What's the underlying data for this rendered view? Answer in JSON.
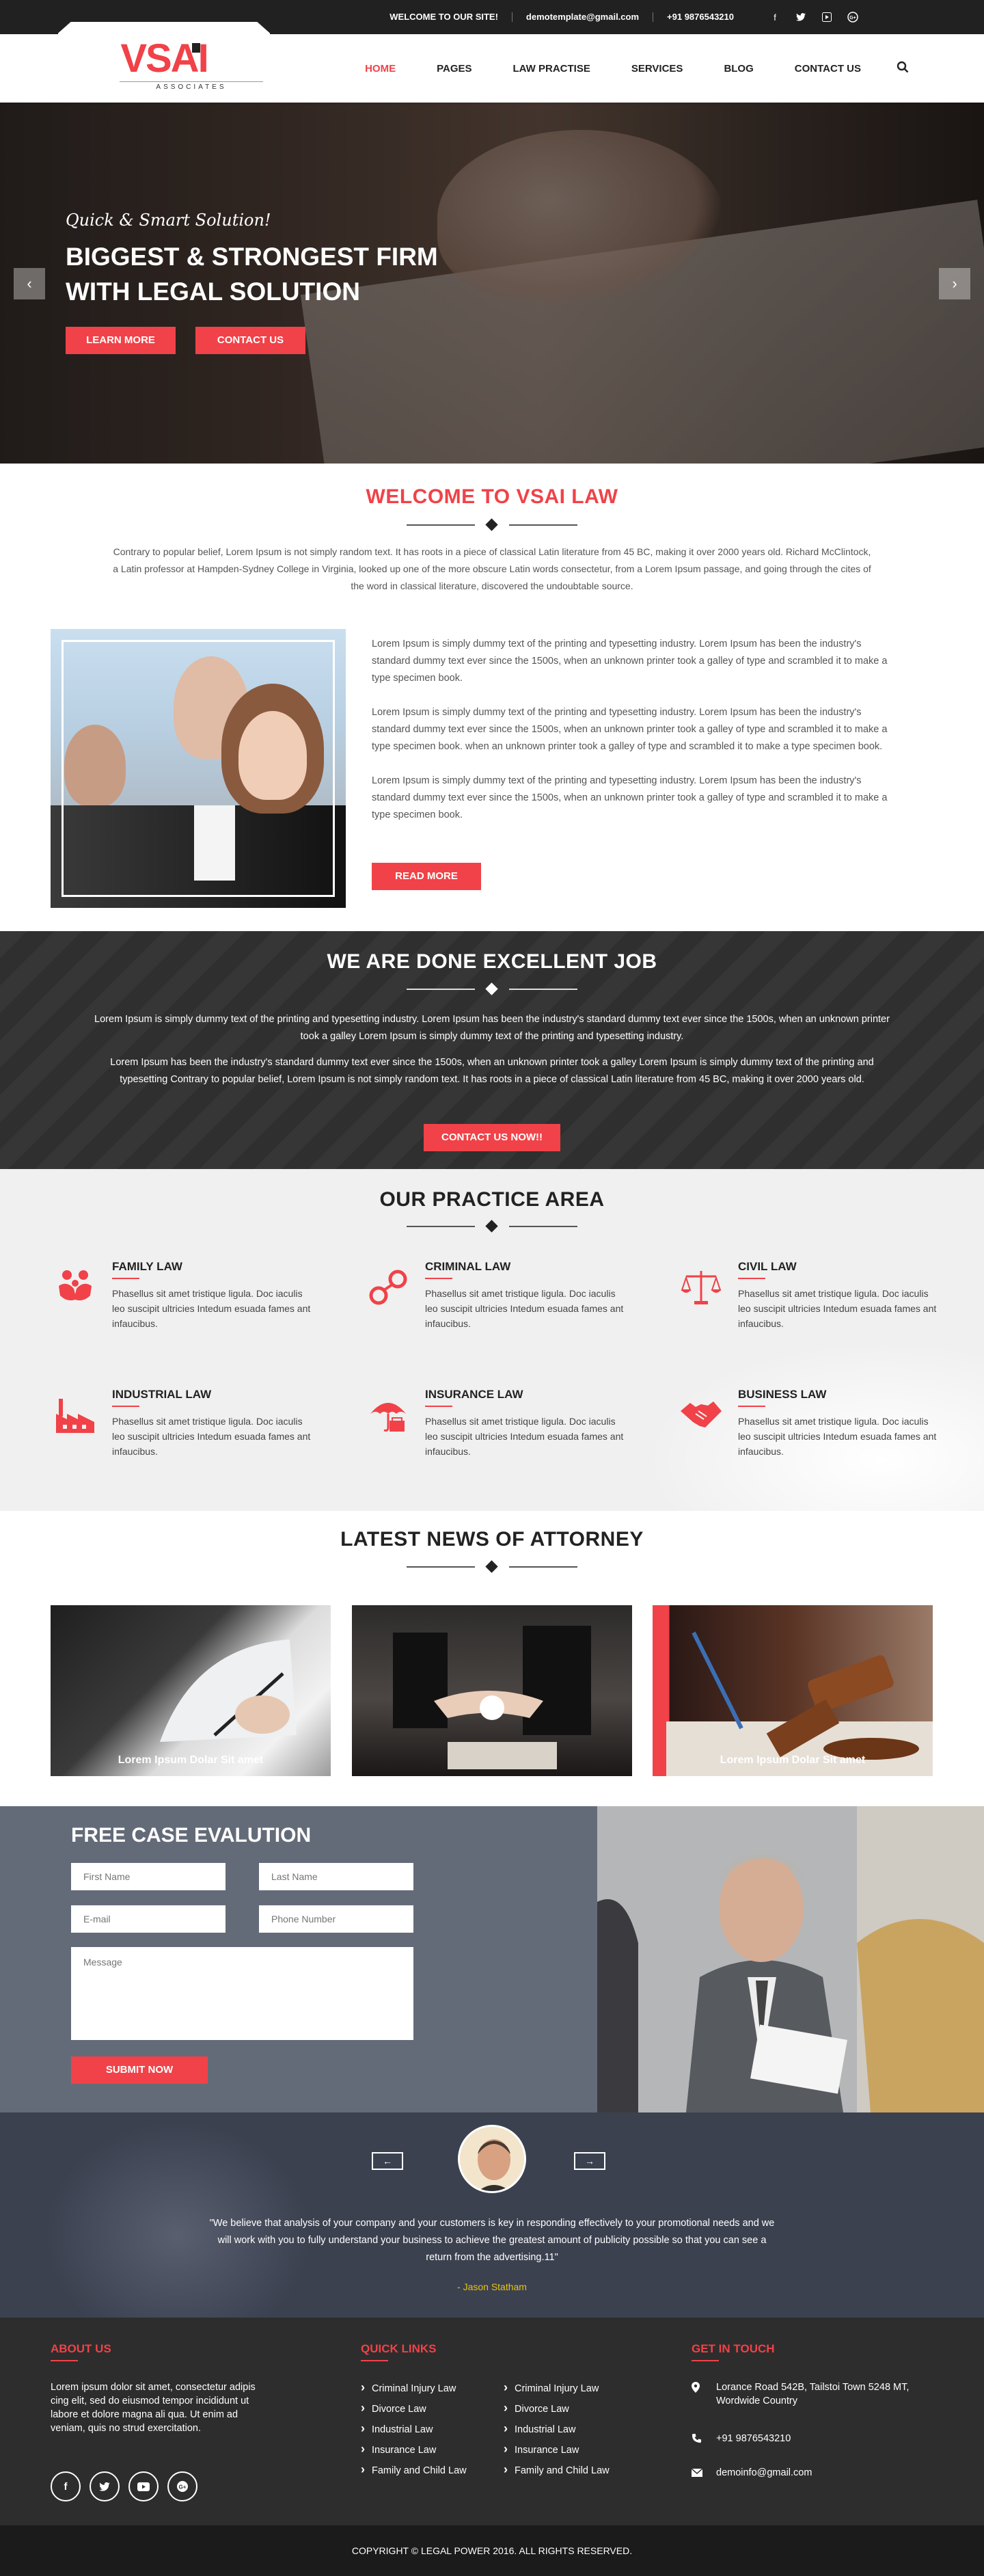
{
  "topbar": {
    "welcome": "WELCOME TO OUR SITE!",
    "email": "demotemplate@gmail.com",
    "phone": "+91 9876543210",
    "social_icons": [
      "facebook-icon",
      "twitter-icon",
      "youtube-icon",
      "google-plus-icon"
    ]
  },
  "logo": {
    "text": "VSAI",
    "sub": "ASSOCIATES"
  },
  "nav": {
    "items": [
      "HOME",
      "PAGES",
      "LAW PRACTISE",
      "SERVICES",
      "BLOG",
      "CONTACT US"
    ],
    "active": "HOME",
    "search_icon": "search-icon"
  },
  "hero": {
    "tagline": "Quick & Smart Solution!",
    "title_line1": "BIGGEST & STRONGEST FIRM",
    "title_line2": "WITH LEGAL SOLUTION",
    "btn_learn": "LEARN MORE",
    "btn_contact": "CONTACT US",
    "prev": "‹",
    "next": "›"
  },
  "welcome": {
    "title": "WELCOME TO VSAI LAW",
    "text": "Contrary to popular belief, Lorem Ipsum is not simply random text. It has roots in a piece of classical Latin literature from 45 BC, making it over 2000 years old. Richard McClintock, a Latin professor at Hampden-Sydney College in Virginia, looked up one of the more obscure Latin words  consectetur, from a Lorem Ipsum passage, and going through the cites of the word in classical literature, discovered the undoubtable source.",
    "paragraphs": [
      "Lorem Ipsum is simply dummy text of the printing and typesetting industry. Lorem Ipsum has been the industry's standard dummy text ever since the 1500s, when an unknown printer took a galley of type and scrambled it to make a type specimen book.",
      "Lorem Ipsum is simply dummy text of the printing and typesetting industry. Lorem Ipsum has been the industry's standard dummy text ever since the 1500s, when an unknown printer took a galley of type and scrambled it to make a type specimen book. when an unknown printer took a galley of type and scrambled it to make a type specimen book.",
      "Lorem Ipsum is simply dummy text of the printing and typesetting industry. Lorem Ipsum has been the industry's standard dummy text ever since the 1500s, when an unknown printer took a galley of type and scrambled it to make a type specimen book."
    ],
    "read_more": "READ MORE"
  },
  "excellent": {
    "title": "WE ARE DONE EXCELLENT JOB",
    "text1": "Lorem Ipsum is simply dummy text of the printing and typesetting industry. Lorem Ipsum has been the industry's standard dummy text ever since the 1500s, when an unknown printer took a galley Lorem Ipsum is simply dummy text of the printing and typesetting industry.",
    "text2": "Lorem Ipsum has been the industry's standard dummy text ever since the 1500s, when an unknown printer took a galley Lorem Ipsum is simply dummy text of the printing and typesetting Contrary to popular belief, Lorem Ipsum is not simply random text. It has roots in a piece of classical Latin literature from 45 BC, making it over 2000 years old.",
    "button": "CONTACT US NOW!!"
  },
  "practice": {
    "title": "OUR PRACTICE AREA",
    "items": [
      {
        "name": "FAMILY LAW",
        "icon": "family-icon",
        "text": "Phasellus sit amet tristique ligula. Doc iaculis leo suscipit ultricies Intedum esuada fames ant infaucibus."
      },
      {
        "name": "CRIMINAL LAW",
        "icon": "handcuffs-icon",
        "text": "Phasellus sit amet tristique ligula. Doc iaculis leo suscipit ultricies Intedum esuada fames ant infaucibus."
      },
      {
        "name": "CIVIL LAW",
        "icon": "scales-icon",
        "text": "Phasellus sit amet tristique ligula. Doc iaculis leo suscipit ultricies Intedum esuada fames ant infaucibus."
      },
      {
        "name": "INDUSTRIAL LAW",
        "icon": "factory-icon",
        "text": "Phasellus sit amet tristique ligula. Doc iaculis leo suscipit ultricies Intedum esuada fames ant infaucibus."
      },
      {
        "name": "INSURANCE LAW",
        "icon": "umbrella-icon",
        "text": "Phasellus sit amet tristique ligula. Doc iaculis leo suscipit ultricies Intedum esuada fames ant infaucibus."
      },
      {
        "name": "BUSINESS LAW",
        "icon": "handshake-icon",
        "text": "Phasellus sit amet tristique ligula. Doc iaculis leo suscipit ultricies Intedum esuada fames ant infaucibus."
      }
    ]
  },
  "news": {
    "title": "LATEST NEWS OF ATTORNEY",
    "cards": [
      {
        "caption": "Lorem Ipsum Dolar Sit amet"
      },
      {
        "caption": ""
      },
      {
        "caption": "Lorem Ipsum Dolar Sit amet"
      }
    ]
  },
  "freecase": {
    "title": "FREE CASE EVALUTION",
    "first_name": "First Name",
    "last_name": "Last Name",
    "email": "E-mail",
    "phone": "Phone Number",
    "message": "Message",
    "submit": "SUBMIT NOW"
  },
  "testimonial": {
    "quote": "\"We believe that analysis of your company and your customers is key in responding effectively to your promotional needs and we will work with you to fully understand your business to achieve the greatest amount of publicity possible so that you can see a return from the advertising.11\"",
    "author": "- Jason Statham",
    "prev": "←",
    "next": "→"
  },
  "footer": {
    "about_title": "ABOUT US",
    "about_text": "Lorem ipsum dolor sit amet, consectetur adipis cing elit, sed do eiusmod tempor incididunt ut labore et dolore magna ali qua. Ut enim ad veniam, quis no strud exercitation.",
    "social": [
      "facebook-icon",
      "twitter-icon",
      "youtube-icon",
      "google-plus-icon"
    ],
    "links_title": "QUICK LINKS",
    "links_col1": [
      "Criminal Injury Law",
      "Divorce Law",
      "Industrial Law",
      "Insurance Law",
      "Family and Child Law"
    ],
    "links_col2": [
      "Criminal Injury Law",
      "Divorce Law",
      "Industrial Law",
      "Insurance Law",
      "Family and Child Law"
    ],
    "contact_title": "GET IN TOUCH",
    "address": "Lorance Road 542B, Tailstoi Town 5248 MT, Wordwide Country",
    "phone": "+91 9876543210",
    "email": "demoinfo@gmail.com"
  },
  "copyright": "COPYRIGHT © LEGAL POWER 2016. ALL RIGHTS RESERVED.",
  "colors": {
    "accent": "#f04248",
    "dark": "#2f2f2f",
    "formbg": "#646b78"
  }
}
